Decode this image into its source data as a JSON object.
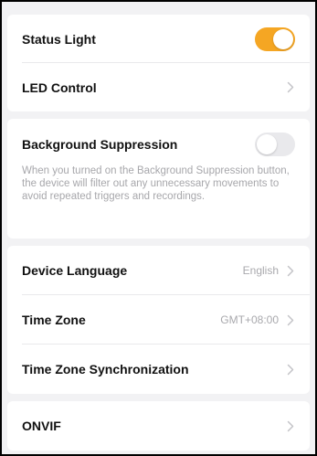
{
  "colors": {
    "accent": "#f5a623",
    "background": "#f2f2f4",
    "card": "#ffffff",
    "label": "#111111",
    "secondary_text": "#a9a9ad"
  },
  "settings": {
    "status_light": {
      "label": "Status Light",
      "enabled": true
    },
    "led_control": {
      "label": "LED Control",
      "icon": "chevron-right-icon"
    },
    "background_suppression": {
      "label": "Background Suppression",
      "enabled": false,
      "description": "When you turned on the Background Suppression button, the device will filter out any unnecessary movements to avoid repeated triggers and recordings."
    },
    "device_language": {
      "label": "Device Language",
      "value": "English"
    },
    "time_zone": {
      "label": "Time Zone",
      "value": "GMT+08:00"
    },
    "time_zone_sync": {
      "label": "Time Zone Synchronization"
    },
    "onvif": {
      "label": "ONVIF"
    }
  }
}
